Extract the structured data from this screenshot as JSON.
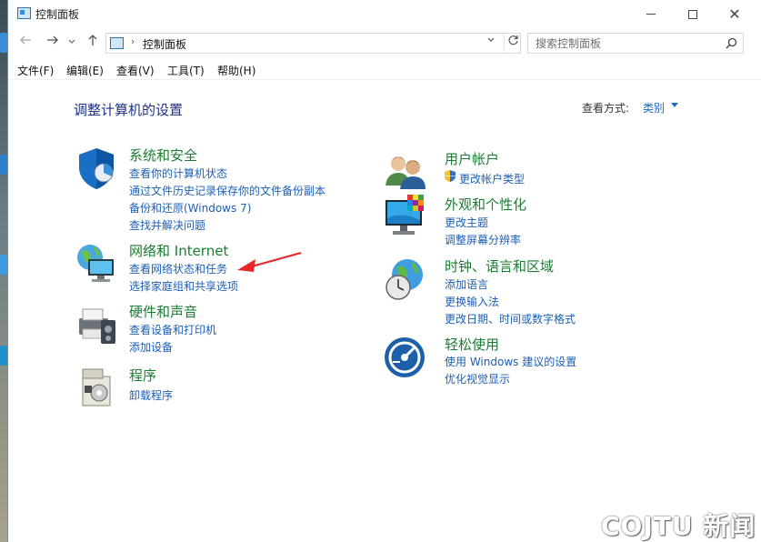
{
  "window": {
    "title": "控制面板"
  },
  "navigation": {
    "breadcrumb": "控制面板",
    "search_placeholder": "搜索控制面板"
  },
  "menu": {
    "items": [
      "文件(F)",
      "编辑(E)",
      "查看(V)",
      "工具(T)",
      "帮助(H)"
    ]
  },
  "content": {
    "heading": "调整计算机的设置",
    "view_by_label": "查看方式:",
    "view_by_value": "类别"
  },
  "categories": {
    "system": {
      "title": "系统和安全",
      "links": [
        "查看你的计算机状态",
        "通过文件历史记录保存你的文件备份副本",
        "备份和还原(Windows 7)",
        "查找并解决问题"
      ]
    },
    "network": {
      "title": "网络和 Internet",
      "links": [
        "查看网络状态和任务",
        "选择家庭组和共享选项"
      ]
    },
    "hardware": {
      "title": "硬件和声音",
      "links": [
        "查看设备和打印机",
        "添加设备"
      ]
    },
    "programs": {
      "title": "程序",
      "links": [
        "卸载程序"
      ]
    },
    "users": {
      "title": "用户帐户",
      "links": [
        "更改帐户类型"
      ]
    },
    "appearance": {
      "title": "外观和个性化",
      "links": [
        "更改主题",
        "调整屏幕分辨率"
      ]
    },
    "clock": {
      "title": "时钟、语言和区域",
      "links": [
        "添加语言",
        "更换输入法",
        "更改日期、时间或数字格式"
      ]
    },
    "ease": {
      "title": "轻松使用",
      "links": [
        "使用 Windows 建议的设置",
        "优化视觉显示"
      ]
    }
  },
  "watermark": "COJTU 新闻",
  "colors": {
    "category_title": "#1a7d32",
    "link": "#1c5fb5",
    "heading": "#1e3287",
    "annotation_arrow": "#e8262a"
  }
}
